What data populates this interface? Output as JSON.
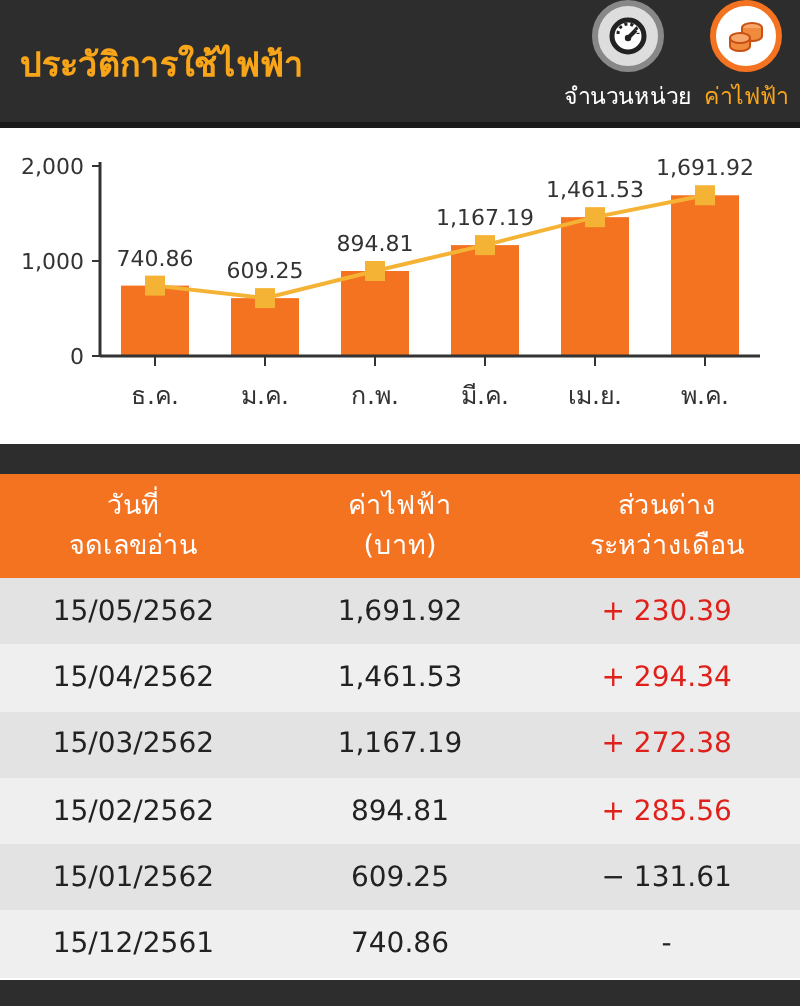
{
  "header": {
    "title": "ประวัติการใช้ไฟฟ้า",
    "toggles": [
      {
        "label": "จำนวนหน่วย",
        "kind": "meter",
        "selected": false
      },
      {
        "label": "ค่าไฟฟ้า",
        "kind": "coins",
        "selected": true
      }
    ]
  },
  "chart_data": {
    "type": "bar",
    "categories": [
      "ธ.ค.",
      "ม.ค.",
      "ก.พ.",
      "มี.ค.",
      "เม.ย.",
      "พ.ค."
    ],
    "series": [
      {
        "color": "#f47321",
        "values": [
          740.86,
          609.25,
          894.81,
          1167.19,
          1461.53,
          1691.92
        ]
      },
      {
        "type": "line",
        "marker": "square",
        "color": "#f5b335",
        "values": [
          740.86,
          609.25,
          894.81,
          1167.19,
          1461.53,
          1691.92
        ]
      }
    ],
    "ylim": [
      0,
      2000
    ],
    "yticks": [
      {
        "value": 0,
        "label": "0"
      },
      {
        "value": 1000,
        "label": "1,000"
      },
      {
        "value": 2000,
        "label": "2,000"
      }
    ],
    "value_labels": [
      "740.86",
      "609.25",
      "894.81",
      "1,167.19",
      "1,461.53",
      "1,691.92"
    ]
  },
  "table": {
    "columns": [
      [
        "วันที่",
        "จดเลขอ่าน"
      ],
      [
        "ค่าไฟฟ้า",
        "(บาท)"
      ],
      [
        "ส่วนต่าง",
        "ระหว่างเดือน"
      ]
    ],
    "rows": [
      {
        "date": "15/05/2562",
        "cost": "1,691.92",
        "diff": "+ 230.39",
        "color": "#e0201b"
      },
      {
        "date": "15/04/2562",
        "cost": "1,461.53",
        "diff": "+ 294.34",
        "color": "#e0201b"
      },
      {
        "date": "15/03/2562",
        "cost": "1,167.19",
        "diff": "+ 272.38",
        "color": "#e0201b"
      },
      {
        "date": "15/02/2562",
        "cost": "894.81",
        "diff": "+ 285.56",
        "color": "#e0201b"
      },
      {
        "date": "15/01/2562",
        "cost": "609.25",
        "diff": "− 131.61",
        "color": "#222222"
      },
      {
        "date": "15/12/2561",
        "cost": "740.86",
        "diff": "-",
        "color": "#222222"
      }
    ]
  }
}
